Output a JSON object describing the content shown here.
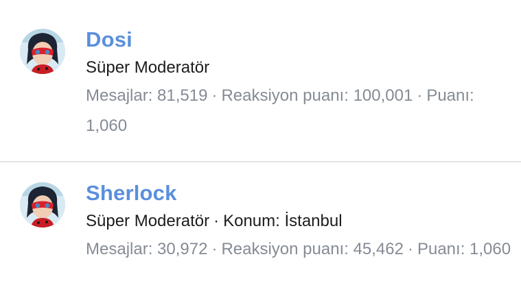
{
  "members": [
    {
      "username": "Dosi",
      "role": "Süper Moderatör",
      "location_label": "",
      "location": "",
      "messages_label": "Mesajlar:",
      "messages": "81,519",
      "reactions_label": "Reaksiyon puanı:",
      "reactions": "100,001",
      "points_label": "Puanı:",
      "points": "1,060",
      "avatar_icon": "ladybug-avatar-icon"
    },
    {
      "username": "Sherlock",
      "role": "Süper Moderatör",
      "location_label": "Konum:",
      "location": "İstanbul",
      "messages_label": "Mesajlar:",
      "messages": "30,972",
      "reactions_label": "Reaksiyon puanı:",
      "reactions": "45,462",
      "points_label": "Puanı:",
      "points": "1,060",
      "avatar_icon": "ladybug-avatar-icon"
    }
  ],
  "separator": "·",
  "colors": {
    "username": "#5a8fdc",
    "stats": "#858b94",
    "text": "#1c1c1c",
    "divider": "#e3e5e8"
  }
}
